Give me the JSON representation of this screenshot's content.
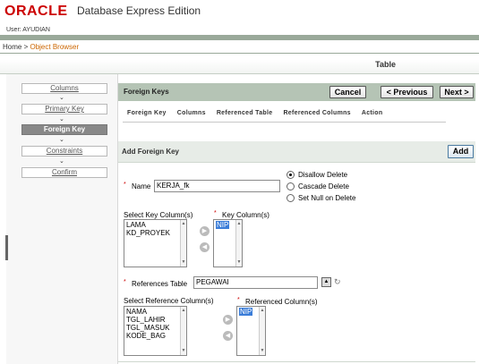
{
  "header": {
    "brand": "ORACLE",
    "product": "Database Express Edition",
    "user_label": "User: AYUDIAN",
    "breadcrumb": {
      "home": "Home",
      "sep": " > ",
      "current": "Object Browser"
    }
  },
  "page_title": "Table",
  "steps": [
    {
      "label": "Columns",
      "active": false
    },
    {
      "label": "Primary Key",
      "active": false
    },
    {
      "label": "Foreign Key",
      "active": true
    },
    {
      "label": "Constraints",
      "active": false
    },
    {
      "label": "Confirm",
      "active": false
    }
  ],
  "step_arrow": "⌄",
  "foreign_keys": {
    "title": "Foreign Keys",
    "buttons": {
      "cancel": "Cancel",
      "previous": "< Previous",
      "next": "Next >"
    },
    "columns": [
      "Foreign Key",
      "Columns",
      "Referenced Table",
      "Referenced Columns",
      "Action"
    ]
  },
  "add_fk": {
    "title": "Add Foreign Key",
    "add_button": "Add",
    "required_mark": "*",
    "name_label": "Name",
    "name_value": "KERJA_fk",
    "on_delete": [
      {
        "label": "Disallow Delete",
        "checked": true
      },
      {
        "label": "Cascade Delete",
        "checked": false
      },
      {
        "label": "Set Null on Delete",
        "checked": false
      }
    ],
    "select_key_label": "Select Key Column(s)",
    "select_key_items": [
      "LAMA",
      "KD_PROYEK"
    ],
    "key_columns_label": "Key Column(s)",
    "key_columns_items": [
      "NIP"
    ],
    "references_label": "References Table",
    "references_value": "PEGAWAI",
    "select_ref_label": "Select Reference Column(s)",
    "select_ref_items": [
      "NAMA",
      "TGL_LAHIR",
      "TGL_MASUK",
      "KODE_BAG"
    ],
    "ref_columns_label": "Referenced Column(s)",
    "ref_columns_items": [
      "NIP"
    ]
  },
  "icons": {
    "move_right": "move-right-icon",
    "move_left": "move-left-icon",
    "lookup": "lookup-icon",
    "refresh": "refresh-icon"
  },
  "colors": {
    "brand": "#cc0000",
    "breadcrumb_current": "#cc6600",
    "header_band": "#b5c4b5",
    "selection": "#3b7dd8"
  }
}
